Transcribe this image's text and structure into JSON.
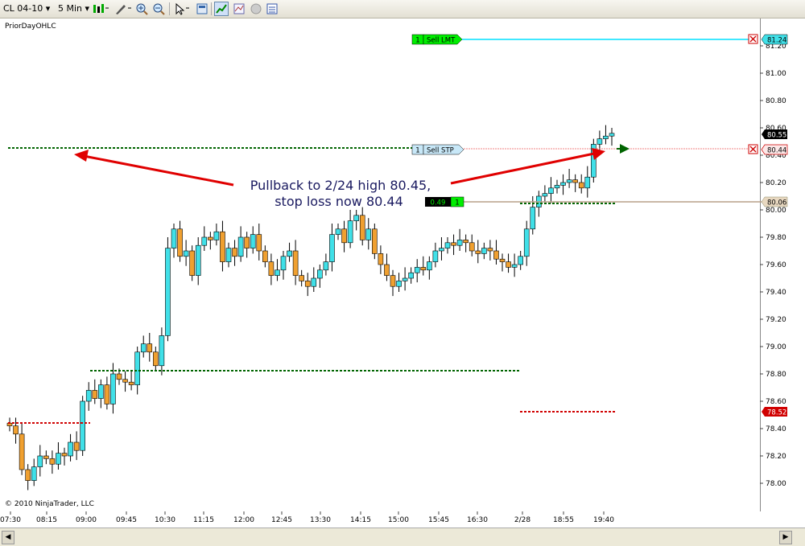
{
  "toolbar": {
    "instrument": "CL 04-10",
    "interval": "5 Min"
  },
  "indicator_label": "PriorDayOHLC",
  "copyright": "© 2010 NinjaTrader, LLC",
  "price_axis": [
    "81.20",
    "81.00",
    "80.80",
    "80.60",
    "80.40",
    "80.20",
    "80.00",
    "79.80",
    "79.60",
    "79.40",
    "79.20",
    "79.00",
    "78.80",
    "78.60",
    "78.40",
    "78.20",
    "78.00"
  ],
  "time_axis": [
    "07:30",
    "08:15",
    "09:00",
    "09:45",
    "10:30",
    "11:15",
    "12:00",
    "12:45",
    "13:30",
    "14:15",
    "15:00",
    "15:45",
    "16:30",
    "2/28",
    "18:55",
    "19:40"
  ],
  "orders": {
    "sell_limit": {
      "qty": "1",
      "label": "Sell LMT",
      "price": "81.24"
    },
    "sell_stop": {
      "qty": "1",
      "label": "Sell STP",
      "price": "80.44"
    },
    "position": {
      "pnl": "0.49",
      "qty": "1",
      "price": "80.06"
    }
  },
  "markers": {
    "last_price": "80.55",
    "prior_low": "78.52"
  },
  "annotation": {
    "line1": "Pullback to 2/24 high 80.45,",
    "line2": "stop loss now 80.44"
  },
  "colors": {
    "up": "#40e0e8",
    "down": "#f0a030",
    "limit_line": "#00e0ff",
    "stop_line": "#f08080",
    "position_line": "#b8a088",
    "green_dotted": "#006400",
    "red_dotted": "#d00000",
    "arrow": "#e00000"
  }
}
